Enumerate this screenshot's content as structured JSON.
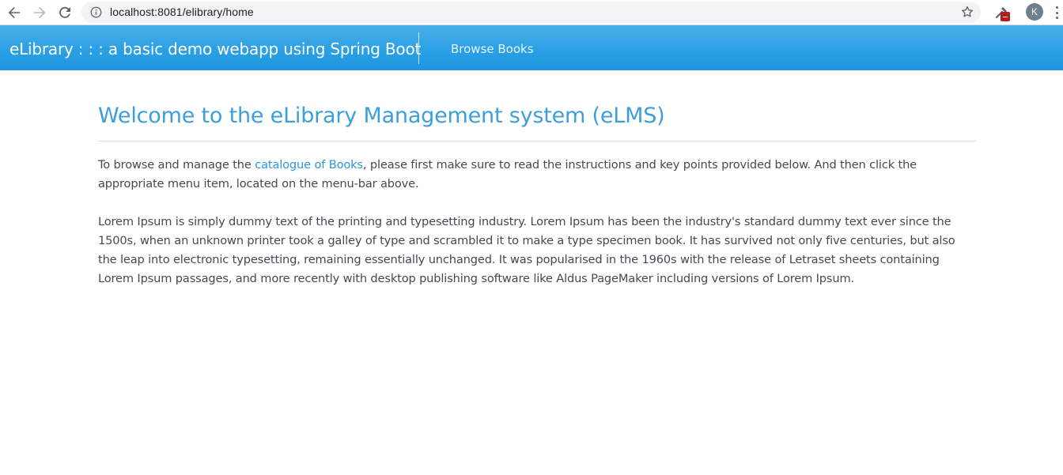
{
  "browser": {
    "url": "localhost:8081/elibrary/home",
    "profile_initial": "K"
  },
  "navbar": {
    "brand": "eLibrary : : : a basic demo webapp using Spring Boot",
    "links": [
      {
        "label": "Browse Books"
      }
    ],
    "colors": {
      "gradient_top": "#4aafe9",
      "gradient_bottom": "#1e95df"
    }
  },
  "main": {
    "title": "Welcome to the eLibrary Management system (eLMS)",
    "intro": {
      "before_link": "To browse and manage the ",
      "link_text": "catalogue of Books",
      "after_link": ", please first make sure to read the instructions and key points provided below. And then click the appropriate menu item, located on the menu-bar above."
    },
    "lorem": "Lorem Ipsum is simply dummy text of the printing and typesetting industry. Lorem Ipsum has been the industry's standard dummy text ever since the 1500s, when an unknown printer took a galley of type and scrambled it to make a type specimen book. It has survived not only five centuries, but also the leap into electronic typesetting, remaining essentially unchanged. It was popularised in the 1960s with the release of Letraset sheets containing Lorem Ipsum passages, and more recently with desktop publishing software like Aldus PageMaker including versions of Lorem Ipsum."
  },
  "icons": {
    "back": "arrow-left-icon",
    "forward": "arrow-right-icon",
    "reload": "reload-icon",
    "site_info": "info-icon",
    "bookmark": "star-icon",
    "extension": "extension-icon",
    "menu": "more-vert-icon"
  }
}
